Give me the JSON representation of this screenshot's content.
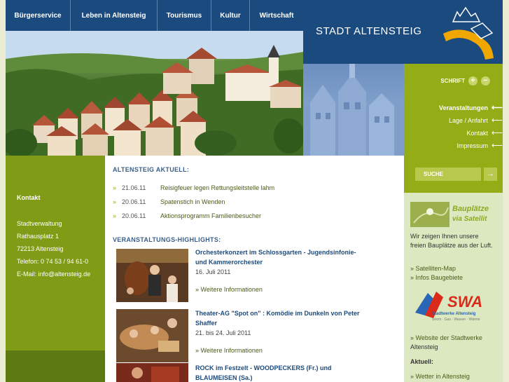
{
  "nav": {
    "items": [
      "Bürgerservice",
      "Leben in Altensteig",
      "Tourismus",
      "Kultur",
      "Wirtschaft"
    ]
  },
  "header": {
    "logo_text": "STADT ALTENSTEIG"
  },
  "right_menu": {
    "schrift_label": "SCHRIFT",
    "plus": "+",
    "minus": "−",
    "items": [
      {
        "label": "Veranstaltungen",
        "bold": true
      },
      {
        "label": "Lage / Anfahrt",
        "bold": false
      },
      {
        "label": "Kontakt",
        "bold": false
      },
      {
        "label": "Impressum",
        "bold": false
      }
    ],
    "arrow": "⟵"
  },
  "contact": {
    "title": "Kontakt",
    "lines": [
      "Stadtverwaltung",
      "Rathausplatz 1",
      "72213 Altensteig",
      "Telefon: 0 74 53 / 94 61-0",
      "E-Mail: info@altensteig.de"
    ]
  },
  "aktuell": {
    "title": "ALTENSTEIG AKTUELL:",
    "bullet": "»",
    "items": [
      {
        "date": "21.06.11",
        "text": "Reisigfeuer legen Rettungsleitstelle lahm"
      },
      {
        "date": "20.06.11",
        "text": "Spatenstich in Wenden"
      },
      {
        "date": "20.06.11",
        "text": "Aktionsprogramm Familienbesucher"
      }
    ]
  },
  "highlights": {
    "title": "VERANSTALTUNGS-HIGHLIGHTS:",
    "more_label": "» Weitere Informationen",
    "events": [
      {
        "title": "Orchesterkonzert im Schlossgarten - Jugendsinfonie- und Kammerorchester",
        "date": "16. Juli 2011"
      },
      {
        "title": "Theater-AG \"Spot on\" : Komödie im Dunkeln von Peter Shaffer",
        "date": "21. bis 24. Juli 2011"
      },
      {
        "title": "ROCK im Festzelt - WOODPECKERS (Fr.) und BLAUMEISEN (Sa.)",
        "date": ""
      }
    ]
  },
  "sidebar": {
    "search_label": "SUCHE",
    "search_arrow": "→",
    "bauplatz_title1": "Bauplätze",
    "bauplatz_title2": "via Satellit",
    "bauplatz_text": "Wir zeigen Ihnen unsere freien Bauplätze aus der Luft.",
    "link_satellite": "» Satelliten-Map",
    "link_infos": "» Infos Baugebiete",
    "swa_logo": "SWA",
    "swa_sub": "Stadtwerke Altensteig",
    "swa_tag": "Strom · Gas · Wasser · Wärme",
    "swa_link_1": "» Website der Stadtwerke",
    "swa_link_2": "Altensteig",
    "aktuell_label": "Aktuell:",
    "aktuell_link": "» Wetter in Altensteig"
  }
}
